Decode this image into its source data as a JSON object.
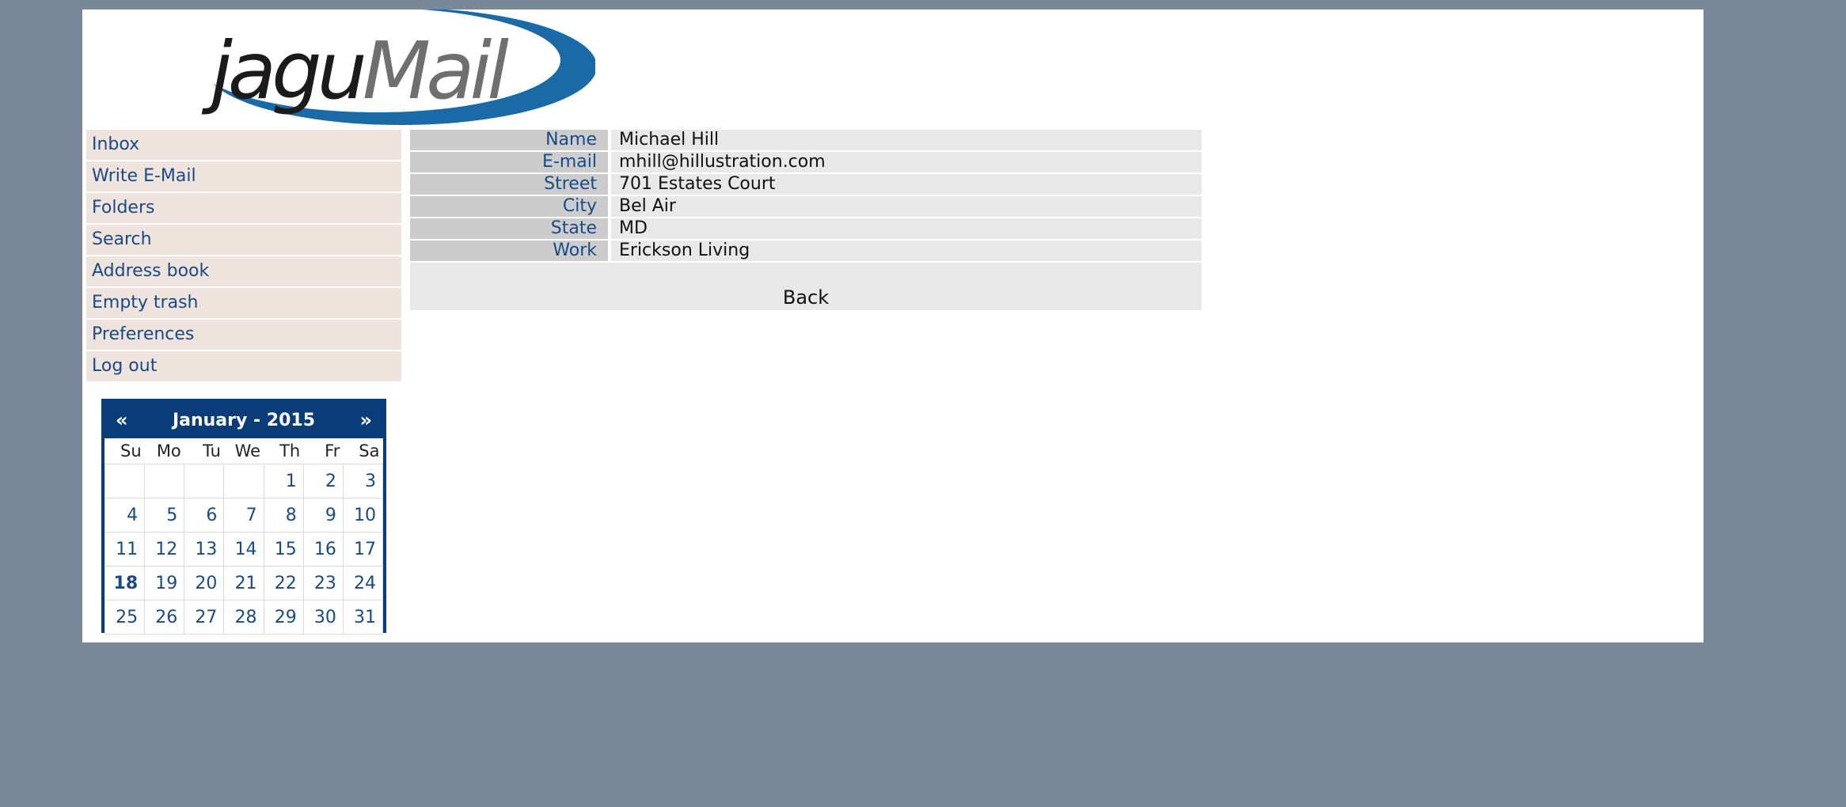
{
  "logo": {
    "text_dark": "jagu",
    "text_gray": "Mail",
    "swoosh_color": "#1a6aa8"
  },
  "menu": {
    "items": [
      {
        "label": "Inbox"
      },
      {
        "label": "Write E-Mail"
      },
      {
        "label": "Folders"
      },
      {
        "label": "Search"
      },
      {
        "label": "Address book"
      },
      {
        "label": "Empty trash"
      },
      {
        "label": "Preferences"
      },
      {
        "label": "Log out"
      }
    ]
  },
  "calendar": {
    "prev": "«",
    "next": "»",
    "title": "January - 2015",
    "weekdays": [
      "Su",
      "Mo",
      "Tu",
      "We",
      "Th",
      "Fr",
      "Sa"
    ],
    "weeks": [
      [
        "",
        "",
        "",
        "",
        "1",
        "2",
        "3"
      ],
      [
        "4",
        "5",
        "6",
        "7",
        "8",
        "9",
        "10"
      ],
      [
        "11",
        "12",
        "13",
        "14",
        "15",
        "16",
        "17"
      ],
      [
        "18",
        "19",
        "20",
        "21",
        "22",
        "23",
        "24"
      ],
      [
        "25",
        "26",
        "27",
        "28",
        "29",
        "30",
        "31"
      ]
    ],
    "today": "18"
  },
  "contact": {
    "fields": [
      {
        "label": "Name",
        "value": "Michael Hill"
      },
      {
        "label": "E-mail",
        "value": "mhill@hillustration.com"
      },
      {
        "label": "Street",
        "value": "701 Estates Court"
      },
      {
        "label": "City",
        "value": "Bel Air"
      },
      {
        "label": "State",
        "value": "MD"
      },
      {
        "label": "Work",
        "value": "Erickson Living"
      }
    ],
    "back_label": "Back"
  },
  "colors": {
    "background": "#7a8999",
    "link": "#1a4a86",
    "calendar_header": "#0b3c7a",
    "menu_bg": "#efe4dd"
  }
}
